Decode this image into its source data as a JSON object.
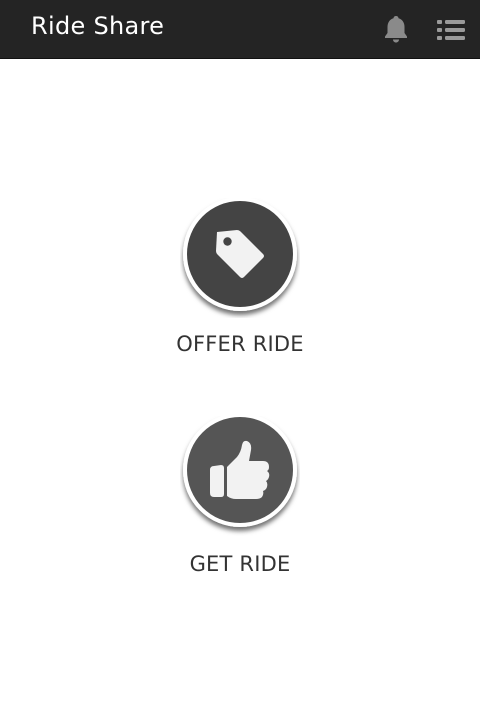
{
  "app": {
    "title": "Ride Share"
  },
  "header": {
    "icons": [
      "bell-icon",
      "menu-list-icon"
    ]
  },
  "actions": [
    {
      "label": "OFFER RIDE",
      "icon": "price-tag-icon"
    },
    {
      "label": "GET RIDE",
      "icon": "thumbs-up-icon"
    }
  ],
  "colors": {
    "topbar": "#242424",
    "title_text": "#ffffff",
    "header_icon": "#8a8a8a",
    "button_fill": "#444444",
    "button_border": "#ffffff",
    "icon_fill": "#f2f2f2",
    "label_text": "#333333",
    "background": "#ffffff"
  }
}
